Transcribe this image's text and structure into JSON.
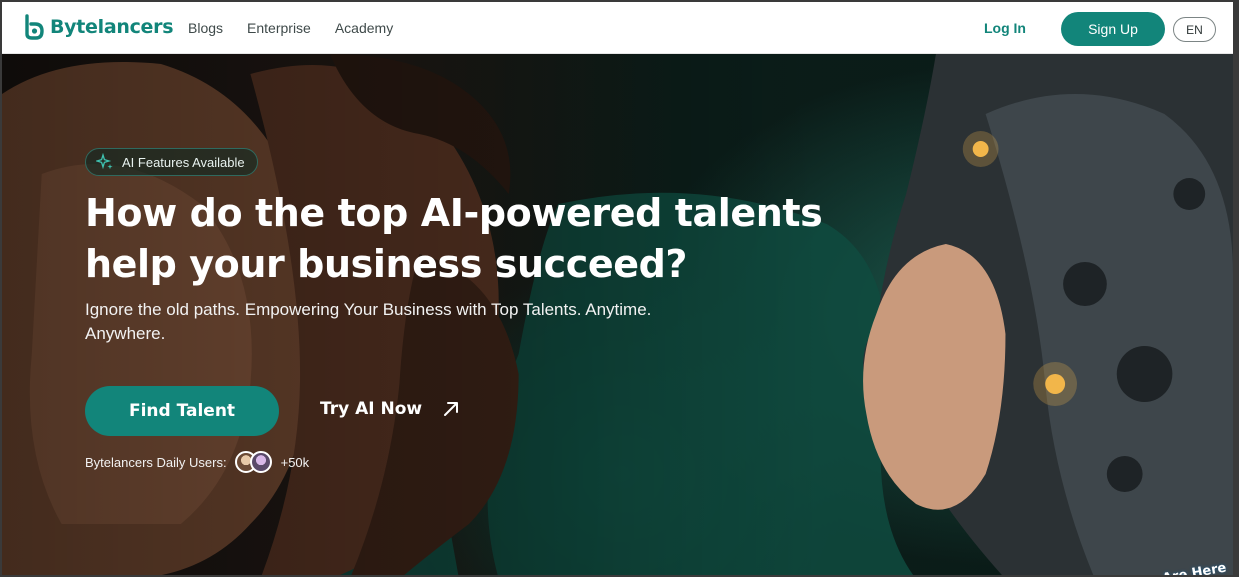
{
  "brand": {
    "name": "Bytelancers",
    "color": "#12857a"
  },
  "nav": {
    "links": [
      "Blogs",
      "Enterprise",
      "Academy"
    ],
    "login": "Log In",
    "signup": "Sign Up",
    "language": "EN"
  },
  "hero": {
    "badge": "AI Features Available",
    "headline": "How do the top AI-powered talents help your business succeed?",
    "subtitle": "Ignore the old paths. Empowering Your Business with Top Talents. Anytime. Anywhere.",
    "primary_cta": "Find Talent",
    "secondary_cta": "Try AI Now",
    "users_label": "Bytelancers Daily Users:",
    "users_count": "+50k",
    "corner_tag": "Are Here"
  }
}
